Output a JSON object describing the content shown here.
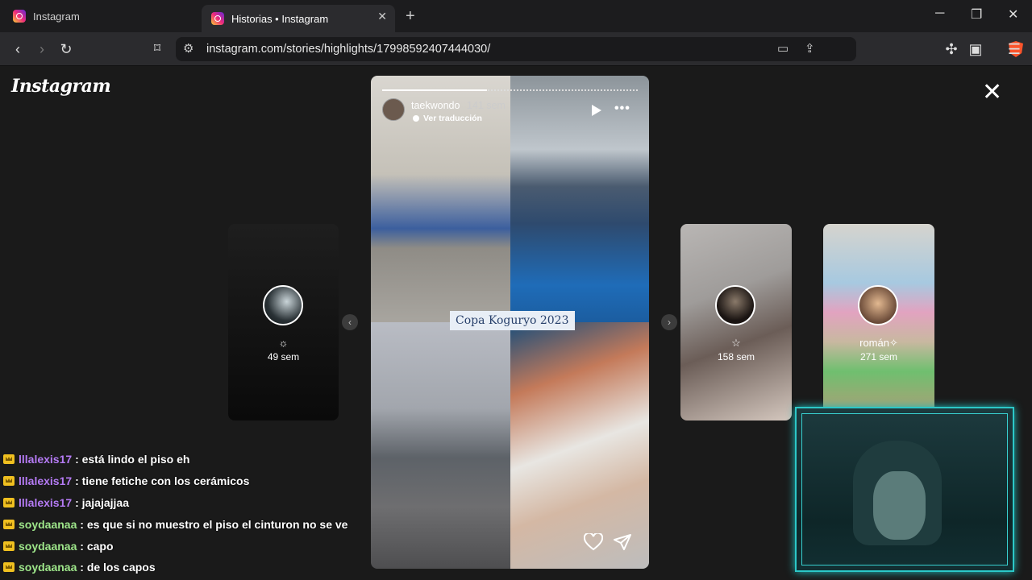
{
  "browser": {
    "tabs": [
      {
        "title": "Instagram",
        "active": false
      },
      {
        "title": "Historias • Instagram",
        "active": true
      }
    ],
    "url": "instagram.com/stories/highlights/17998592407444030/",
    "new_tab": "+",
    "window": {
      "minimize": "─",
      "restore": "❐",
      "close": "✕"
    }
  },
  "instagram": {
    "logo": "Instagram",
    "close": "✕",
    "prev_card": {
      "glyph": "☼",
      "time": "49 sem"
    },
    "story": {
      "username": "taekwondo",
      "time": "141 sem",
      "translate": "Ver traducción",
      "caption": "Copa Koguryo 2023",
      "progress": 0.41
    },
    "next_cards": [
      {
        "glyph": "☆",
        "time": "158 sem"
      },
      {
        "glyph": "román✧",
        "time": "271 sem"
      }
    ],
    "nav": {
      "prev": "‹",
      "next": "›"
    }
  },
  "chat": [
    {
      "user": "lllalexis17",
      "color": "#b57bf5",
      "text": ": está lindo el piso eh"
    },
    {
      "user": "lllalexis17",
      "color": "#b57bf5",
      "text": ": tiene fetiche con los cerámicos"
    },
    {
      "user": "lllalexis17",
      "color": "#b57bf5",
      "text": ": jajajajjaa"
    },
    {
      "user": "soydaanaa",
      "color": "#9ee68a",
      "text": ": es que si no muestro el piso el cinturon no se ve"
    },
    {
      "user": "soydaanaa",
      "color": "#9ee68a",
      "text": ": capo"
    },
    {
      "user": "soydaanaa",
      "color": "#9ee68a",
      "text": ": de los capos"
    }
  ]
}
